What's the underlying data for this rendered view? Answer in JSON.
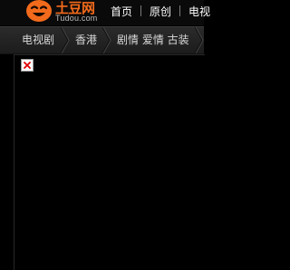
{
  "header": {
    "logo": {
      "name": "土豆网",
      "domain": "Tudou.com"
    },
    "nav": [
      {
        "label": "首页"
      },
      {
        "label": "原创"
      },
      {
        "label": "电视"
      }
    ]
  },
  "breadcrumb": [
    {
      "label": "电视剧"
    },
    {
      "label": "香港"
    },
    {
      "label": "剧情 爱情 古装"
    }
  ],
  "content": {
    "image": "broken-image-icon"
  }
}
